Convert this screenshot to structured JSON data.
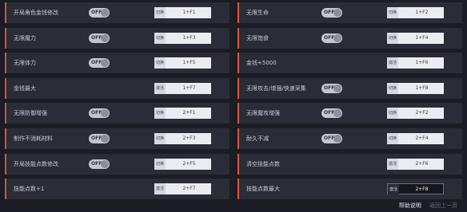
{
  "rows": [
    [
      {
        "label": "开局角色金钱修改",
        "toggle": "OFF",
        "action": "切换",
        "key": "1+F1"
      },
      {
        "label": "无限生命",
        "toggle": "OFF",
        "action": "切换",
        "key": "1+F2"
      }
    ],
    [
      {
        "label": "无限魔力",
        "toggle": "OFF",
        "action": "切换",
        "key": "1+F3"
      },
      {
        "label": "无限饱食",
        "toggle": "OFF",
        "action": "切换",
        "key": "1+F4"
      }
    ],
    [
      {
        "label": "无限体力",
        "toggle": "OFF",
        "action": "切换",
        "key": "1+F5"
      },
      {
        "label": "金钱+5000",
        "toggle": null,
        "action": "激活",
        "key": "1+F6"
      }
    ],
    [
      {
        "label": "金钱最大",
        "toggle": null,
        "action": "激活",
        "key": "1+F7"
      },
      {
        "label": "无限攻击/增强/快速采集",
        "toggle": "OFF",
        "action": "切换",
        "key": "1+F8"
      }
    ],
    [
      {
        "label": "无限防御增强",
        "toggle": "OFF",
        "action": "切换",
        "key": "2+F1"
      },
      {
        "label": "无限魔攻增强",
        "toggle": "OFF",
        "action": "切换",
        "key": "2+F2"
      }
    ],
    [
      {
        "label": "制作不消耗材料",
        "toggle": "OFF",
        "action": "切换",
        "key": "2+F3"
      },
      {
        "label": "耐久不减",
        "toggle": "OFF",
        "action": "切换",
        "key": "2+F4"
      }
    ],
    [
      {
        "label": "开局技能点数修改",
        "toggle": "OFF",
        "action": "切换",
        "key": "2+F5"
      },
      {
        "label": "清空技能点数",
        "toggle": null,
        "action": "激活",
        "key": "2+F6"
      }
    ],
    [
      {
        "label": "技能点数+1",
        "toggle": null,
        "action": "激活",
        "key": "2+F7"
      },
      {
        "label": "技能点数最大",
        "toggle": null,
        "action": "激活",
        "key": "2+F8",
        "active": true
      }
    ]
  ],
  "footer": {
    "help": "帮助说明",
    "back": "返回上一页"
  }
}
